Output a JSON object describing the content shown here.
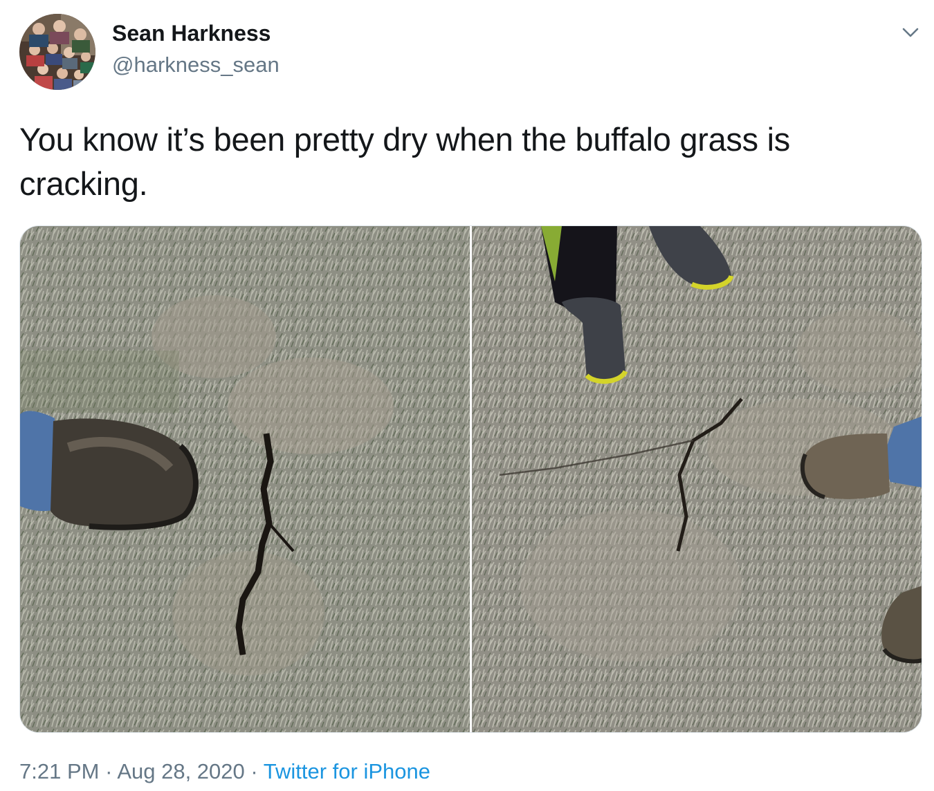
{
  "tweet": {
    "author": {
      "display_name": "Sean Harkness",
      "handle": "@harkness_sean",
      "avatar_icon": "family-photo-avatar"
    },
    "menu_icon": "chevron-down-icon",
    "text": "You know it’s been pretty dry when the buffalo grass is cracking.",
    "media": [
      {
        "icon": "photo-cracked-grass-boot"
      },
      {
        "icon": "photo-cracked-grass-two-boots"
      }
    ],
    "time": "7:21 PM",
    "date": "Aug 28, 2020",
    "separator": "·",
    "source": "Twitter for iPhone"
  },
  "colors": {
    "text": "#14171a",
    "secondary": "#657786",
    "link": "#1b95e0",
    "border": "#e1e8ed"
  }
}
